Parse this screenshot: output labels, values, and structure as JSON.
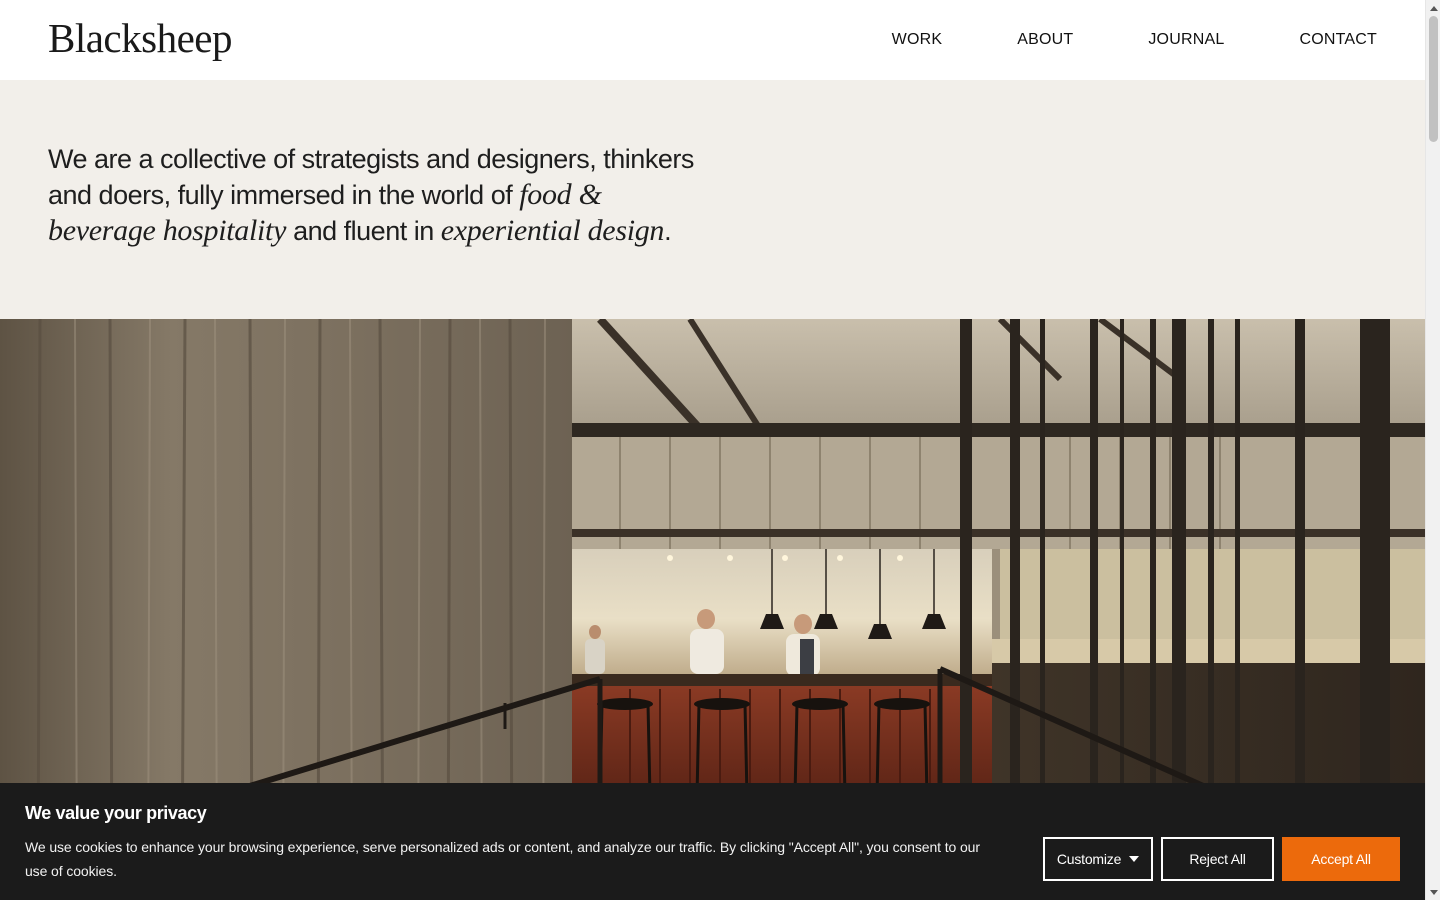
{
  "header": {
    "logo": "Blacksheep",
    "nav": [
      "WORK",
      "ABOUT",
      "JOURNAL",
      "CONTACT"
    ]
  },
  "intro": {
    "part1": "We are a collective of strategists and designers, thinkers and doers, fully immersed in the world of ",
    "em1": "food & beverage hospitality",
    "part2": " and fluent in ",
    "em2": "experiential design",
    "part3": "."
  },
  "hero": {
    "image": "restaurant-open-kitchen-photo"
  },
  "cookie": {
    "title": "We value your privacy",
    "text": "We use cookies to enhance your browsing experience, serve personalized ads or content, and analyze our traffic. By clicking \"Accept All\", you consent to our use of cookies.",
    "customize_label": "Customize",
    "reject_label": "Reject All",
    "accept_label": "Accept All"
  },
  "colors": {
    "accent": "#ec6a0c",
    "intro_bg": "#f2efea",
    "banner_bg": "#1b1b1b"
  },
  "icons": [
    "caret-down-icon",
    "scroll-up-icon",
    "scroll-down-icon"
  ]
}
